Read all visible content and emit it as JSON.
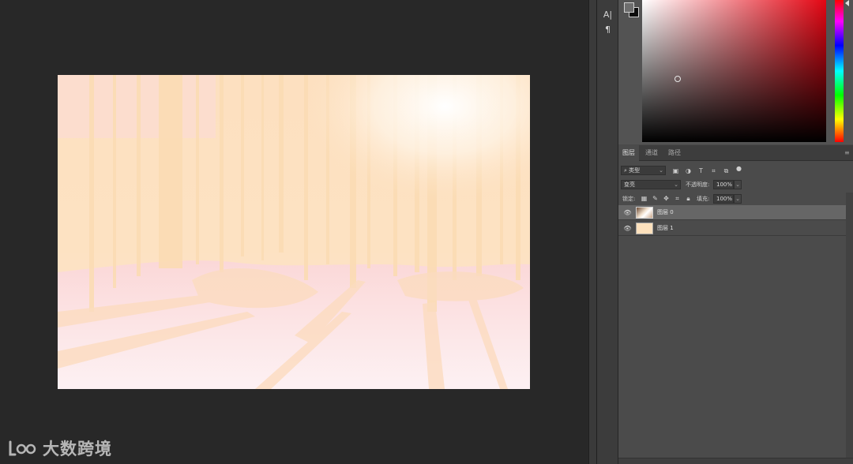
{
  "tools": {
    "type_tool_label": "A|",
    "paragraph_tool_label": "¶"
  },
  "color_panel": {
    "foreground_color": "#6e6e6e",
    "background_color": "#0c0c0c",
    "picker_base_hue": "#e30613"
  },
  "layers_panel": {
    "tabs": [
      {
        "label": "图层",
        "active": true
      },
      {
        "label": "通道",
        "active": false
      },
      {
        "label": "路径",
        "active": false
      }
    ],
    "filter": {
      "search_icon": "⌕",
      "label": "类型"
    },
    "filter_icons": [
      "image-filter-icon",
      "adjustment-filter-icon",
      "type-filter-icon",
      "shape-filter-icon",
      "smartobject-filter-icon",
      "filter-toggle-icon"
    ],
    "blend_mode": "变亮",
    "opacity": {
      "label": "不透明度:",
      "value": "100%"
    },
    "lock": {
      "label": "锁定:"
    },
    "fill": {
      "label": "填充:",
      "value": "100%"
    },
    "layers": [
      {
        "name": "图层 0",
        "selected": true
      },
      {
        "name": "图层 1",
        "selected": false
      }
    ]
  },
  "watermark": {
    "text": "大数跨境"
  }
}
